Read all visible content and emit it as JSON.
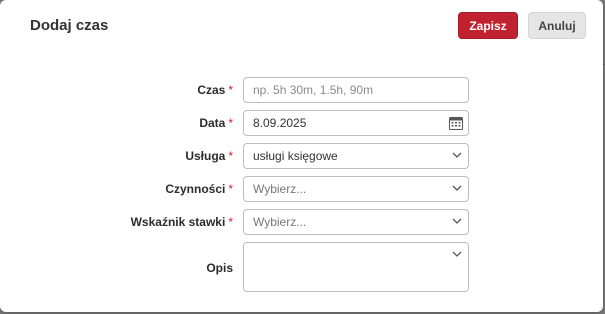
{
  "dialog": {
    "title": "Dodaj czas",
    "save_label": "Zapisz",
    "cancel_label": "Anuluj"
  },
  "form": {
    "required_marker": "*",
    "fields": [
      {
        "label": "Czas",
        "placeholder": "np. 5h 30m, 1.5h, 90m",
        "value": ""
      },
      {
        "label": "Data",
        "value": "8.09.2025",
        "icon": "calendar-icon"
      },
      {
        "label": "Usługa",
        "value": "usługi księgowe",
        "icon": "chevron-down-icon"
      },
      {
        "label": "Czynności",
        "placeholder": "Wybierz...",
        "icon": "chevron-down-icon"
      },
      {
        "label": "Wskaźnik stawki",
        "placeholder": "Wybierz...",
        "icon": "chevron-down-icon"
      },
      {
        "label": "Opis",
        "value": "",
        "icon": "chevron-down-icon"
      }
    ]
  },
  "colors": {
    "primary": "#c1222f",
    "required": "#d0212f"
  }
}
